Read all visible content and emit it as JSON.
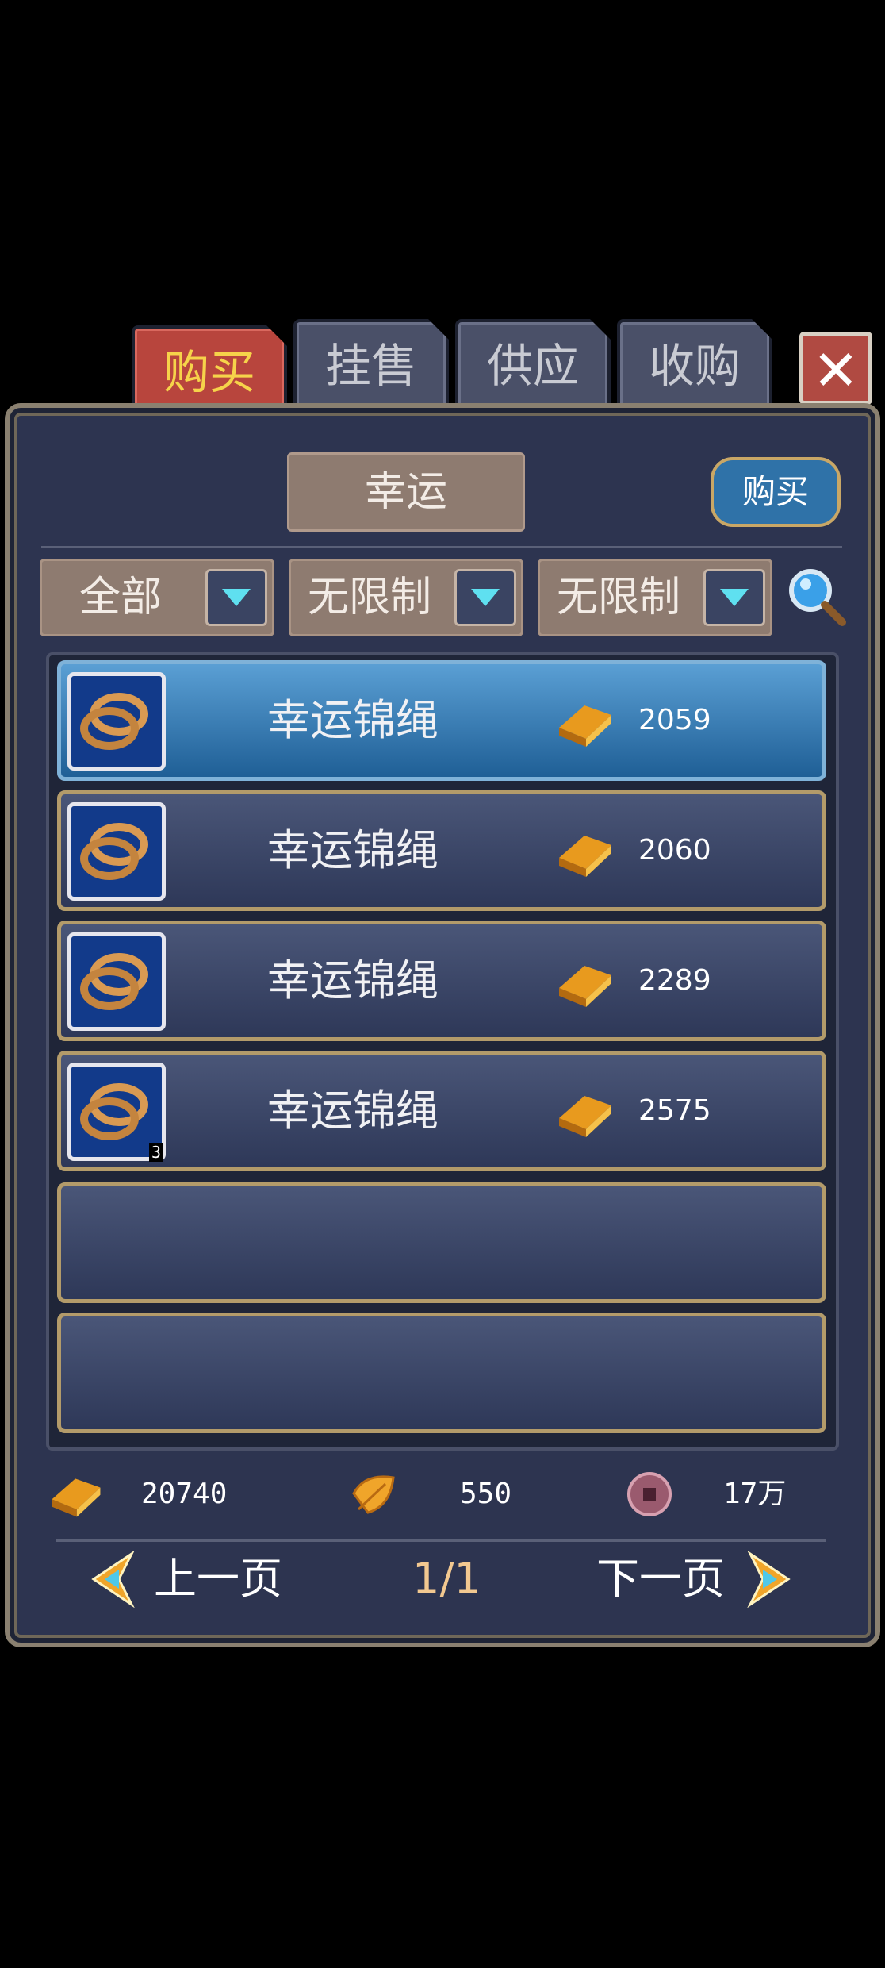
{
  "tabs": [
    {
      "label": "购买",
      "active": true
    },
    {
      "label": "挂售",
      "active": false
    },
    {
      "label": "供应",
      "active": false
    },
    {
      "label": "收购",
      "active": false
    }
  ],
  "close_icon": "close-icon",
  "category_title": "幸运",
  "buy_button_label": "购买",
  "filters": [
    {
      "value": "全部"
    },
    {
      "value": "无限制"
    },
    {
      "value": "无限制"
    }
  ],
  "search_icon": "magnifier-icon",
  "items": [
    {
      "name": "幸运锦绳",
      "price": "2059",
      "qty": "",
      "selected": true
    },
    {
      "name": "幸运锦绳",
      "price": "2060",
      "qty": "",
      "selected": false
    },
    {
      "name": "幸运锦绳",
      "price": "2289",
      "qty": "",
      "selected": false
    },
    {
      "name": "幸运锦绳",
      "price": "2575",
      "qty": "3",
      "selected": false
    }
  ],
  "currencies": {
    "gold": "20740",
    "leaf": "550",
    "coin": "17万"
  },
  "pagination": {
    "prev_label": "上一页",
    "page": "1/1",
    "next_label": "下一页"
  },
  "colors": {
    "active_tab": "#b8453d",
    "active_tab_text": "#f6d34a",
    "selected_row": "#2f6fa6",
    "row_border": "#b39b6a"
  }
}
